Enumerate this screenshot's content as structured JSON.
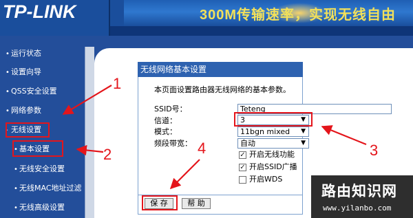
{
  "header": {
    "logo": "TP-LINK",
    "banner": "300M传输速率，实现无线自由"
  },
  "sidebar": {
    "items": [
      {
        "label": "运行状态"
      },
      {
        "label": "设置向导"
      },
      {
        "label": "QSS安全设置"
      },
      {
        "label": "网络参数"
      },
      {
        "label": "无线设置"
      },
      {
        "label": "基本设置"
      },
      {
        "label": "无线安全设置"
      },
      {
        "label": "无线MAC地址过滤"
      },
      {
        "label": "无线高级设置"
      }
    ]
  },
  "panel": {
    "title": "无线网络基本设置",
    "description": "本页面设置路由器无线网络的基本参数。",
    "fields": {
      "ssid_label": "SSID号：",
      "ssid_value": "Teteng",
      "channel_label": "信道：",
      "channel_value": "3",
      "mode_label": "模式：",
      "mode_value": "11bgn mixed",
      "bandwidth_label": "频段带宽：",
      "bandwidth_value": "自动"
    },
    "checkboxes": [
      {
        "label": "开启无线功能",
        "checked": true
      },
      {
        "label": "开启SSID广播",
        "checked": true
      },
      {
        "label": "开启WDS",
        "checked": false
      }
    ],
    "buttons": {
      "save": "保 存",
      "help": "帮 助"
    }
  },
  "annotations": {
    "n1": "1",
    "n2": "2",
    "n3": "3",
    "n4": "4",
    "color": "#e4151b"
  },
  "watermark": {
    "title": "路由知识网",
    "url": "www.yilanbo.com"
  },
  "icons": {
    "dropdown": "triangle-down-icon",
    "check": "checkmark-icon"
  }
}
